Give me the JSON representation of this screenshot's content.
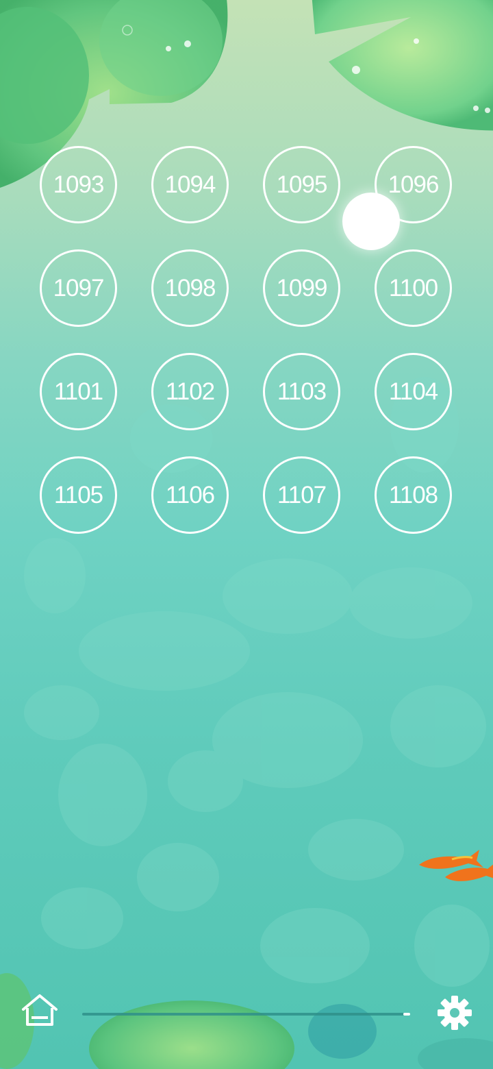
{
  "levels": {
    "items": [
      "1093",
      "1094",
      "1095",
      "1096",
      "1097",
      "1098",
      "1099",
      "1100",
      "1101",
      "1102",
      "1103",
      "1104",
      "1105",
      "1106",
      "1107",
      "1108"
    ]
  },
  "icons": {
    "home": "home-icon",
    "settings": "gear-icon"
  },
  "colors": {
    "ring": "#ffffff",
    "lily_pad": "#5cc47c",
    "water_bottom": "#52c4b2",
    "koi": "#f0731c"
  }
}
